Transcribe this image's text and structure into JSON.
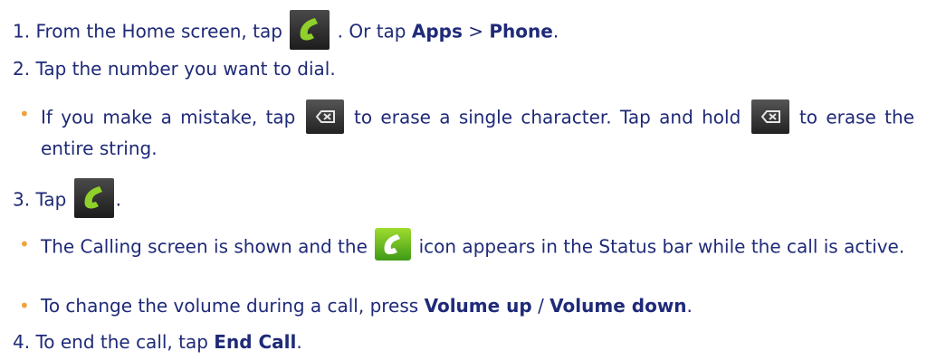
{
  "steps": {
    "s1": {
      "a": "1. From the Home screen, tap",
      "b": ". Or tap",
      "apps": "Apps",
      "gt": ">",
      "phone": "Phone",
      "end": "."
    },
    "s2": {
      "text": "2. Tap the number you want to dial."
    },
    "b1": {
      "a": "If you make a mistake, tap",
      "b": "to erase a single character. Tap and hold",
      "c": "to erase the entire string."
    },
    "s3": {
      "a": "3. Tap",
      "end": "."
    },
    "b2": {
      "a": "The Calling screen is shown and the",
      "b": "icon appears in the Status bar while the call is active."
    },
    "b3": {
      "a": "To change the volume during a call, press",
      "vu": "Volume up",
      "slash": "/",
      "vd": "Volume down",
      "end": "."
    },
    "s4": {
      "a": "4. To end the call, tap",
      "ec": "End Call",
      "end": "."
    }
  },
  "bullet_char": "•",
  "icons": [
    "phone-dial-icon",
    "backspace-icon",
    "call-notification-icon"
  ],
  "colors": {
    "text": "#1f2a78",
    "bullet": "#f0a33a",
    "green": "#6cc21f"
  }
}
